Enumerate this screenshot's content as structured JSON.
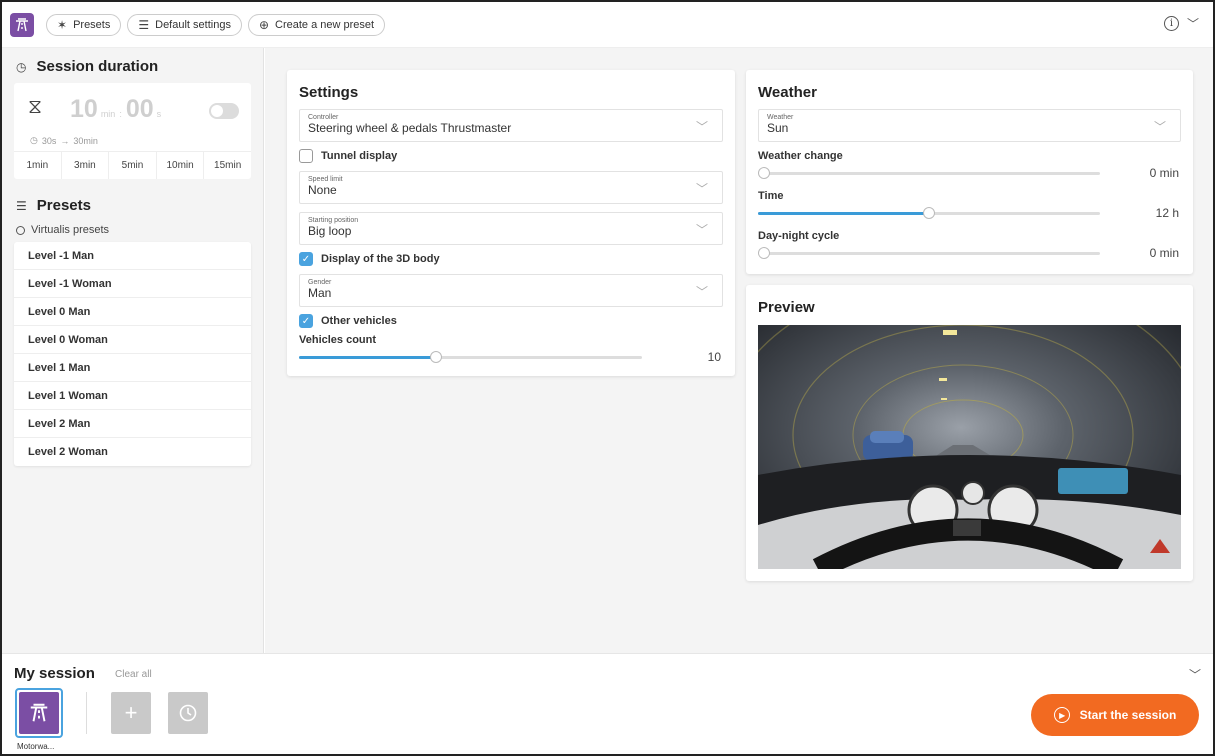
{
  "topbar": {
    "presets_label": "Presets",
    "default_settings_label": "Default settings",
    "create_preset_label": "Create a new preset"
  },
  "sidebar": {
    "duration_title": "Session duration",
    "minutes": "10",
    "minutes_unit": "min",
    "seconds": "00",
    "seconds_unit": "s",
    "separator": ":",
    "range_min": "30s",
    "range_arrow": "→",
    "range_max": "30min",
    "quick_options": [
      "1min",
      "3min",
      "5min",
      "10min",
      "15min"
    ],
    "presets_title": "Presets",
    "presets_source": "Virtualis presets",
    "preset_items": [
      "Level -1 Man",
      "Level -1 Woman",
      "Level 0 Man",
      "Level 0 Woman",
      "Level 1 Man",
      "Level 1 Woman",
      "Level 2 Man",
      "Level 2 Woman"
    ]
  },
  "settings": {
    "title": "Settings",
    "controller": {
      "label": "Controller",
      "value": "Steering wheel & pedals Thrustmaster"
    },
    "tunnel_display": {
      "label": "Tunnel display",
      "checked": false
    },
    "speed_limit": {
      "label": "Speed limit",
      "value": "None"
    },
    "starting_position": {
      "label": "Starting position",
      "value": "Big loop"
    },
    "display_3d_body": {
      "label": "Display of the 3D body",
      "checked": true
    },
    "gender": {
      "label": "Gender",
      "value": "Man"
    },
    "other_vehicles": {
      "label": "Other vehicles",
      "checked": true
    },
    "vehicles_count": {
      "label": "Vehicles count",
      "value": "10",
      "fraction": 0.4
    }
  },
  "weather": {
    "title": "Weather",
    "weather_select": {
      "label": "Weather",
      "value": "Sun"
    },
    "weather_change": {
      "label": "Weather change",
      "value": "0 min",
      "fraction": 0.0
    },
    "time": {
      "label": "Time",
      "value": "12 h",
      "fraction": 0.5
    },
    "day_night": {
      "label": "Day-night cycle",
      "value": "0 min",
      "fraction": 0.0
    }
  },
  "preview": {
    "title": "Preview"
  },
  "session": {
    "title": "My session",
    "clear_all": "Clear all",
    "tile_caption": "Motorwa...",
    "start_label": "Start the session"
  },
  "colors": {
    "accent_blue": "#3a9bd8",
    "brand_purple": "#7b4ea4",
    "start_orange": "#f26a21"
  }
}
